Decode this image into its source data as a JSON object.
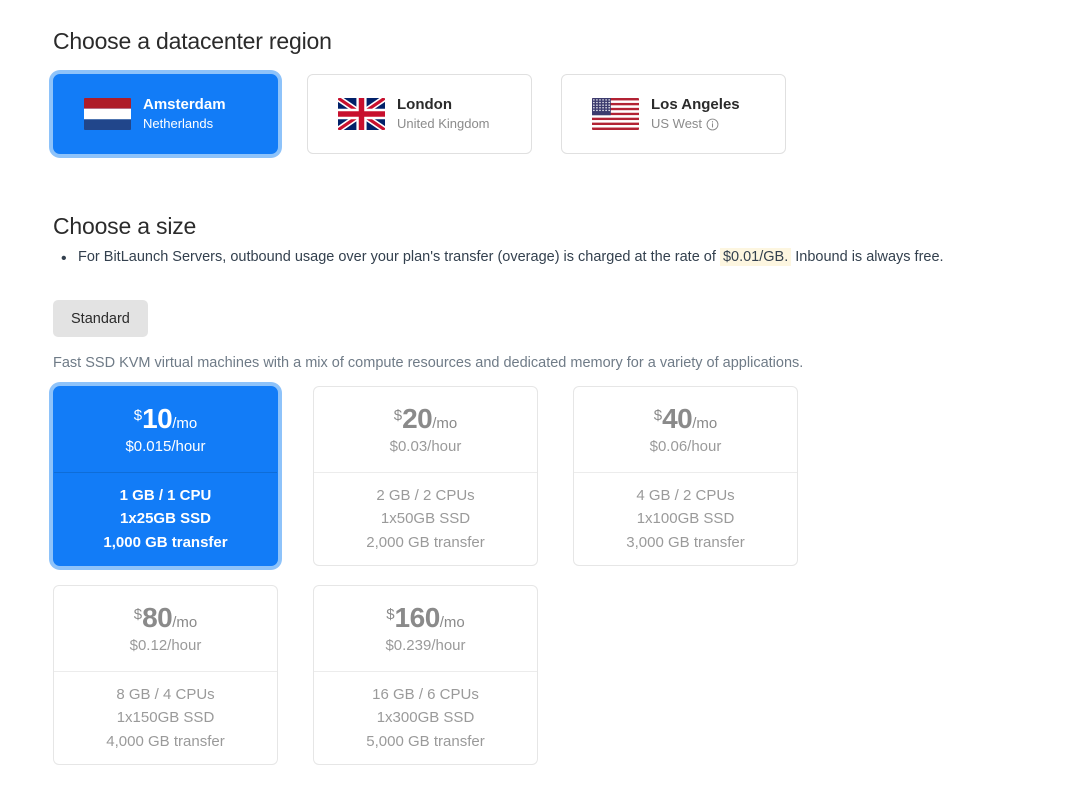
{
  "sections": {
    "region_title": "Choose a datacenter region",
    "size_title": "Choose a size"
  },
  "regions": [
    {
      "name": "Amsterdam",
      "sub": "Netherlands",
      "flag": "flag-netherlands",
      "selected": true,
      "has_info_icon": false
    },
    {
      "name": "London",
      "sub": "United Kingdom",
      "flag": "flag-united-kingdom",
      "selected": false,
      "has_info_icon": false
    },
    {
      "name": "Los Angeles",
      "sub": "US West",
      "flag": "flag-united-states",
      "selected": false,
      "has_info_icon": true
    }
  ],
  "note": {
    "before": "For BitLaunch Servers, outbound usage over your plan's transfer (overage) is charged at the rate of",
    "highlight": "$0.01/GB.",
    "after": "Inbound is always free.",
    "highlight_color": "#fdf6e0"
  },
  "tabs": [
    {
      "label": "Standard",
      "selected": true
    }
  ],
  "description": "Fast SSD KVM virtual machines with a mix of compute resources and dedicated memory for a variety of applications.",
  "plans": [
    {
      "currency": "$",
      "amount": "10",
      "period": "/mo",
      "hourly": "$0.015/hour",
      "specs": [
        "1 GB / 1 CPU",
        "1x25GB SSD",
        "1,000 GB transfer"
      ],
      "selected": true
    },
    {
      "currency": "$",
      "amount": "20",
      "period": "/mo",
      "hourly": "$0.03/hour",
      "specs": [
        "2 GB / 2 CPUs",
        "1x50GB SSD",
        "2,000 GB transfer"
      ],
      "selected": false
    },
    {
      "currency": "$",
      "amount": "40",
      "period": "/mo",
      "hourly": "$0.06/hour",
      "specs": [
        "4 GB / 2 CPUs",
        "1x100GB SSD",
        "3,000 GB transfer"
      ],
      "selected": false
    },
    {
      "currency": "$",
      "amount": "80",
      "period": "/mo",
      "hourly": "$0.12/hour",
      "specs": [
        "8 GB / 4 CPUs",
        "1x150GB SSD",
        "4,000 GB transfer"
      ],
      "selected": false
    },
    {
      "currency": "$",
      "amount": "160",
      "period": "/mo",
      "hourly": "$0.239/hour",
      "specs": [
        "16 GB / 6 CPUs",
        "1x300GB SSD",
        "5,000 GB transfer"
      ],
      "selected": false
    }
  ],
  "colors": {
    "accent_blue": "#127cf7",
    "accent_ring": "#8ec3fa",
    "tab_bg": "#e3e3e3",
    "muted_text": "#9a9a9a"
  }
}
